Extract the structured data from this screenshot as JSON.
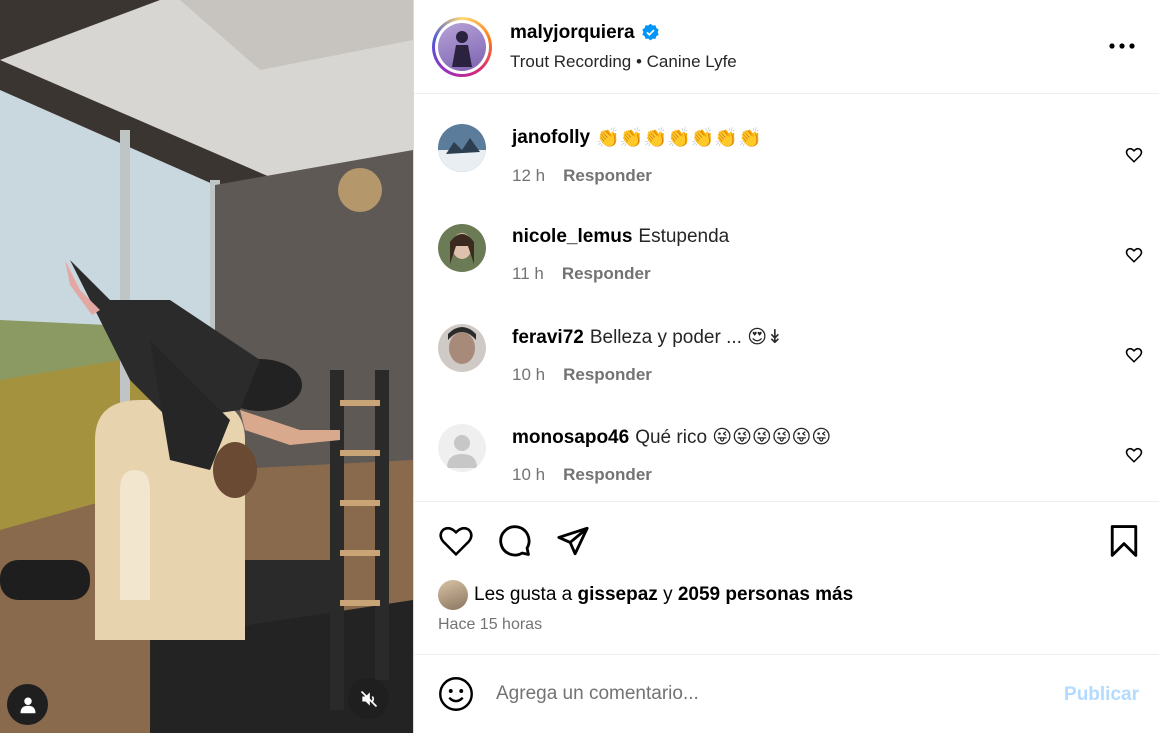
{
  "post": {
    "username": "malyjorquiera",
    "subtitle": "Trout Recording • Canine Lyfe",
    "verified_icon": "verified-badge-icon",
    "more_icon": "more-options-icon"
  },
  "comments": [
    {
      "username": "janofolly",
      "text": "👏👏👏👏👏👏👏",
      "time": "12 h",
      "reply_label": "Responder",
      "avatar_color": "#5b7c9a"
    },
    {
      "username": "nicole_lemus",
      "text": "Estupenda",
      "time": "11 h",
      "reply_label": "Responder",
      "avatar_color": "#6b7b55"
    },
    {
      "username": "feravi72",
      "text": "Belleza y poder ... 😍↡",
      "time": "10 h",
      "reply_label": "Responder",
      "avatar_color": "#8a7468"
    },
    {
      "username": "monosapo46",
      "text": "Qué rico 😜😜😜😜😜😜",
      "time": "10 h",
      "reply_label": "Responder",
      "avatar_color": "#dbdbdb"
    }
  ],
  "likes": {
    "prefix": "Les gusta a",
    "user": "gissepaz",
    "connector": "y",
    "others": "2059 personas más",
    "time_ago": "Hace 15 horas"
  },
  "comment_box": {
    "placeholder": "Agrega un comentario...",
    "publish_label": "Publicar"
  },
  "colors": {
    "accent_blue": "#0095f6",
    "publish_disabled": "#b3dbff",
    "muted_text": "#737373"
  }
}
